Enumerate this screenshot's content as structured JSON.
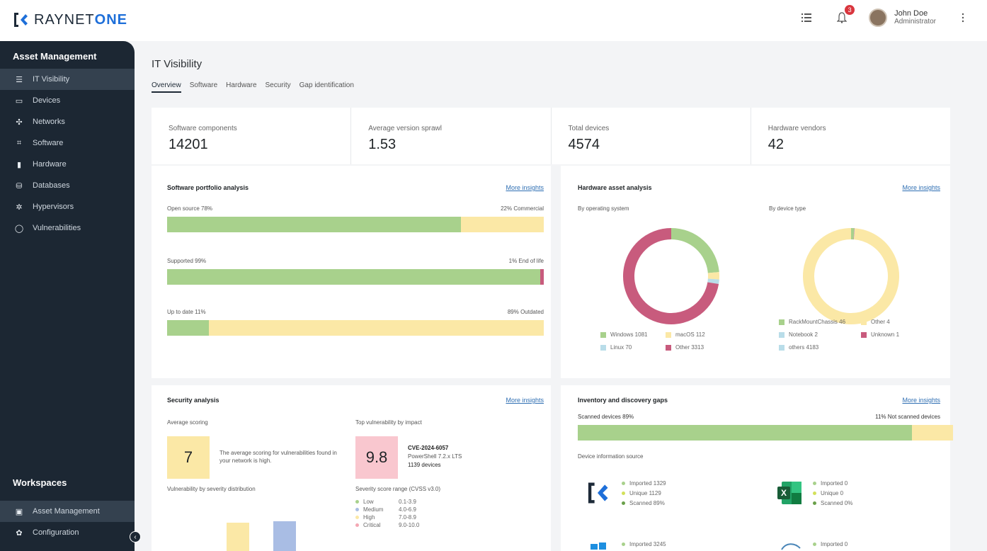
{
  "brand": {
    "name_part1": "RAYNET",
    "name_part2": "ONE"
  },
  "header": {
    "notification_count": "3",
    "user": {
      "name": "John Doe",
      "role": "Administrator"
    }
  },
  "sidebar": {
    "section_title": "Asset Management",
    "items": [
      {
        "label": "IT Visibility",
        "icon": "list-icon",
        "active": true
      },
      {
        "label": "Devices",
        "icon": "laptop-icon"
      },
      {
        "label": "Networks",
        "icon": "network-icon"
      },
      {
        "label": "Software",
        "icon": "software-icon"
      },
      {
        "label": "Hardware",
        "icon": "hardware-icon"
      },
      {
        "label": "Databases",
        "icon": "database-icon"
      },
      {
        "label": "Hypervisors",
        "icon": "hypervisor-icon"
      },
      {
        "label": "Vulnerabilities",
        "icon": "shield-icon"
      }
    ],
    "workspaces_title": "Workspaces",
    "workspaces": [
      {
        "label": "Asset Management",
        "icon": "briefcase-icon",
        "active": true
      },
      {
        "label": "Configuration",
        "icon": "gear-icon"
      }
    ]
  },
  "page": {
    "title": "IT Visibility",
    "tabs": [
      "Overview",
      "Software",
      "Hardware",
      "Security",
      "Gap identification"
    ]
  },
  "kpis": [
    {
      "label": "Software components",
      "value": "14201"
    },
    {
      "label": "Average version sprawl",
      "value": "1.53"
    },
    {
      "label": "Total devices",
      "value": "4574"
    },
    {
      "label": "Hardware vendors",
      "value": "42"
    }
  ],
  "software_portfolio": {
    "title": "Software portfolio analysis",
    "link": "More insights",
    "bars": [
      {
        "left_label": "Open source 78%",
        "right_label": "22% Commercial",
        "parts": [
          {
            "color": "g",
            "pct": 78
          },
          {
            "color": "y",
            "pct": 22
          }
        ]
      },
      {
        "left_label": "Supported 99%",
        "right_label": "1% End of life",
        "parts": [
          {
            "color": "g",
            "pct": 99
          },
          {
            "color": "r",
            "pct": 1
          }
        ]
      },
      {
        "left_label": "Up to date 11%",
        "right_label": "89% Outdated",
        "parts": [
          {
            "color": "g",
            "pct": 11
          },
          {
            "color": "y",
            "pct": 89
          }
        ]
      }
    ]
  },
  "hardware_analysis": {
    "title": "Hardware asset analysis",
    "link": "More insights",
    "by_os_label": "By operating system",
    "by_type_label": "By device type",
    "os_legend": [
      {
        "label": "Windows 1081",
        "color": "#a8d18c"
      },
      {
        "label": "macOS 112",
        "color": "#fbe8a6"
      },
      {
        "label": "Linux 70",
        "color": "#b9dde9"
      },
      {
        "label": "Other 3313",
        "color": "#c85b7d"
      }
    ],
    "type_legend": [
      {
        "label": "RackMountChassis 46",
        "color": "#a8d18c"
      },
      {
        "label": "Other 4",
        "color": "#fbe8a6"
      },
      {
        "label": "Notebook 2",
        "color": "#b9dde9"
      },
      {
        "label": "Unknown 1",
        "color": "#c85b7d"
      },
      {
        "label": "others 4183",
        "color": "#b9dde9"
      }
    ]
  },
  "chart_data": [
    {
      "type": "pie",
      "title": "By operating system",
      "categories": [
        "Windows",
        "macOS",
        "Linux",
        "Other"
      ],
      "values": [
        1081,
        112,
        70,
        3313
      ],
      "colors": [
        "#a8d18c",
        "#fbe8a6",
        "#b9dde9",
        "#c85b7d"
      ]
    },
    {
      "type": "pie",
      "title": "By device type",
      "categories": [
        "RackMountChassis",
        "Other",
        "Notebook",
        "Unknown",
        "others"
      ],
      "values": [
        46,
        4,
        2,
        1,
        4183
      ],
      "colors": [
        "#a8d18c",
        "#c85b7d",
        "#b9dde9",
        "#c85b7d",
        "#fbe8a6"
      ]
    }
  ],
  "security": {
    "title": "Security analysis",
    "link": "More insights",
    "avg_label": "Average scoring",
    "avg_value": "7",
    "avg_text": "The average scoring for vulnerabilities found in your network is high.",
    "top_label": "Top vulnerability by impact",
    "top_score": "9.8",
    "top_cve": "CVE-2024-6057",
    "top_product": "PowerShell 7.2.x LTS",
    "top_devices": "1139 devices",
    "dist_label": "Vulnerability by severity distribution",
    "range_label": "Severity score range (CVSS v3.0)",
    "ranges": [
      {
        "name": "Low",
        "range": "0.1-3.9",
        "color": "#a8d18c"
      },
      {
        "name": "Medium",
        "range": "4.0-6.9",
        "color": "#a9bde4"
      },
      {
        "name": "High",
        "range": "7.0-8.9",
        "color": "#fbe8a6"
      },
      {
        "name": "Critical",
        "range": "9.0-10.0",
        "color": "#f4a7b3"
      }
    ]
  },
  "inventory": {
    "title": "Inventory and discovery gaps",
    "link": "More insights",
    "left_label": "Scanned devices 89%",
    "right_label": "11% Not scanned devices",
    "scanned_pct": 89,
    "source_label": "Device information source",
    "sources": [
      {
        "name": "raynet",
        "items": [
          {
            "label": "Imported 1329",
            "color": "#a8d18c"
          },
          {
            "label": "Unique 1129",
            "color": "#d3e15a"
          },
          {
            "label": "Scanned 89%",
            "color": "#6aa04a"
          }
        ]
      },
      {
        "name": "excel",
        "items": [
          {
            "label": "Imported 0",
            "color": "#a8d18c"
          },
          {
            "label": "Unique 0",
            "color": "#d3e15a"
          },
          {
            "label": "Scanned 0%",
            "color": "#6aa04a"
          }
        ]
      },
      {
        "name": "windows",
        "items": [
          {
            "label": "Imported 3245",
            "color": "#a8d18c"
          }
        ]
      },
      {
        "name": "other",
        "items": [
          {
            "label": "Imported 0",
            "color": "#a8d18c"
          }
        ]
      }
    ]
  }
}
